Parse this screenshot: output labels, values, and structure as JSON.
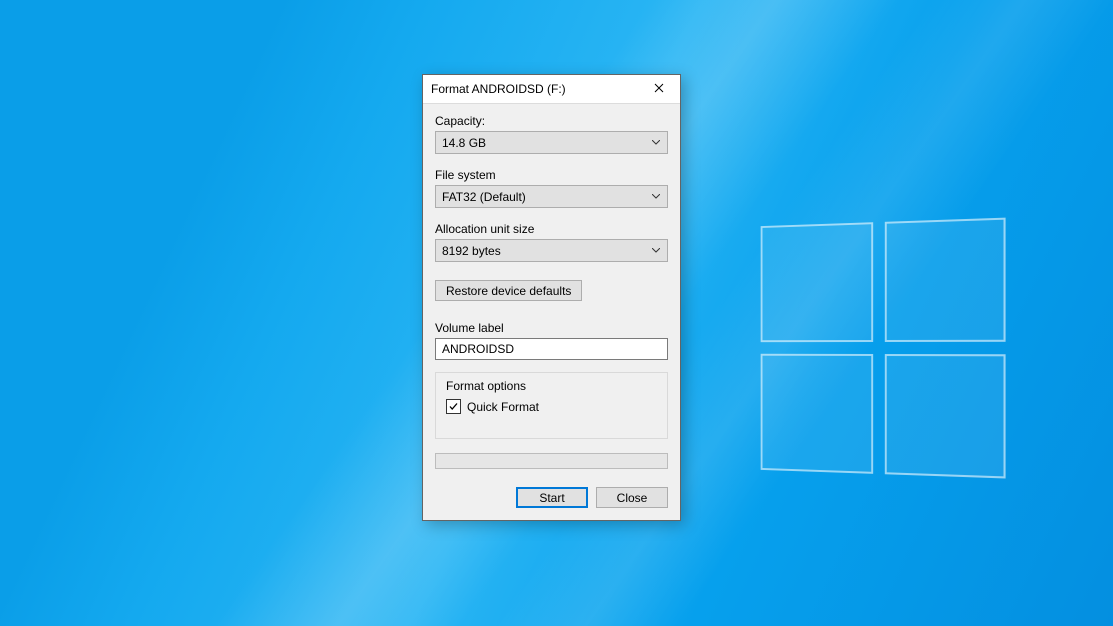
{
  "dialog": {
    "title": "Format ANDROIDSD (F:)",
    "capacity_label": "Capacity:",
    "capacity_value": "14.8 GB",
    "filesystem_label": "File system",
    "filesystem_value": "FAT32 (Default)",
    "allocation_label": "Allocation unit size",
    "allocation_value": "8192 bytes",
    "restore_defaults": "Restore device defaults",
    "volume_label_label": "Volume label",
    "volume_label_value": "ANDROIDSD",
    "format_options_legend": "Format options",
    "quick_format_label": "Quick Format",
    "quick_format_checked": true,
    "start_button": "Start",
    "close_button": "Close"
  }
}
